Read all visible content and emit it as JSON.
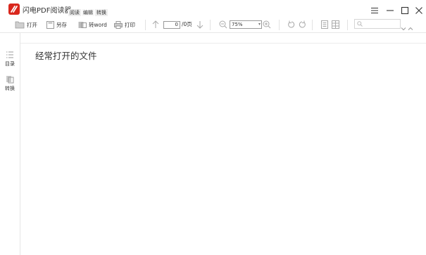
{
  "app": {
    "title": "闪电PDF阅读器",
    "accent": "#d9271d"
  },
  "tabs": [
    {
      "label": "阅读"
    },
    {
      "label": "编辑"
    },
    {
      "label": "转换"
    }
  ],
  "window_controls": [
    "menu-icon",
    "minimize-icon",
    "maximize-icon",
    "close-icon"
  ],
  "toolbar": {
    "open_label": "打开",
    "saveas_label": "另存",
    "toword_label": "转word",
    "print_label": "打印",
    "page_current": "0",
    "page_total": "/0页",
    "zoom_value": "75%",
    "search_placeholder": ""
  },
  "sidebar": {
    "items": [
      {
        "label": "目录"
      },
      {
        "label": "转换"
      }
    ]
  },
  "main": {
    "heading": "经常打开的文件"
  }
}
